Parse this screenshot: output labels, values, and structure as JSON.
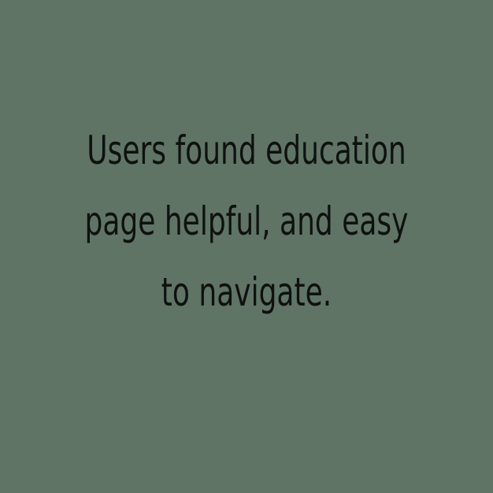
{
  "background_color": "#5f7465",
  "text_color": "#0f1110",
  "statement": {
    "lines": [
      "Users found education",
      "page helpful, and easy",
      "to navigate."
    ]
  }
}
